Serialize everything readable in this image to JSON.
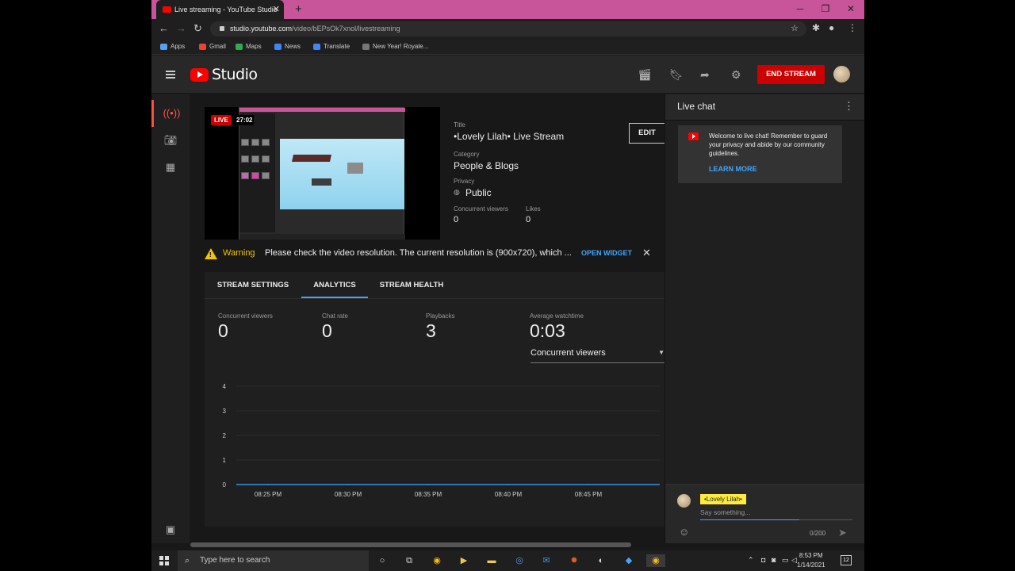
{
  "browser": {
    "tab_title": "Live streaming - YouTube Studio",
    "url_domain": "studio.youtube.com",
    "url_path": "/video/bEPsOk7xnol/livestreaming",
    "bookmarks": [
      "Apps",
      "Gmail",
      "Maps",
      "News",
      "Translate",
      "New Year! Royale..."
    ]
  },
  "header": {
    "logo_text": "Studio",
    "end_stream_label": "END STREAM"
  },
  "player": {
    "live_label": "LIVE",
    "elapsed": "27:02"
  },
  "stream_info": {
    "title_label": "Title",
    "title_value": "•Lovely Lilah• Live Stream",
    "category_label": "Category",
    "category_value": "People & Blogs",
    "privacy_label": "Privacy",
    "privacy_value": "Public",
    "viewers_label": "Concurrent viewers",
    "viewers_value": "0",
    "likes_label": "Likes",
    "likes_value": "0",
    "edit_label": "EDIT"
  },
  "warning": {
    "title": "Warning",
    "text": "Please check the video resolution. The current resolution is (900x720), which ...",
    "action": "OPEN WIDGET"
  },
  "tabs": [
    "STREAM SETTINGS",
    "ANALYTICS",
    "STREAM HEALTH"
  ],
  "active_tab": "ANALYTICS",
  "stats": [
    {
      "label": "Concurrent viewers",
      "value": "0"
    },
    {
      "label": "Chat rate",
      "value": "0"
    },
    {
      "label": "Playbacks",
      "value": "3"
    },
    {
      "label": "Average watchtime",
      "value": "0:03"
    }
  ],
  "metric_select": "Concurrent viewers",
  "chart_data": {
    "type": "line",
    "x": [
      "08:25 PM",
      "08:30 PM",
      "08:35 PM",
      "08:40 PM",
      "08:45 PM"
    ],
    "series": [
      {
        "values": [
          0,
          0,
          0,
          0,
          0
        ]
      }
    ],
    "yticks": [
      0,
      1,
      2,
      3,
      4
    ],
    "ylim": [
      0,
      4
    ],
    "grid": true,
    "line_color": "#3ea6ff"
  },
  "chat": {
    "title": "Live chat",
    "welcome": "Welcome to live chat! Remember to guard your privacy and abide by our community guidelines.",
    "learn_more": "LEARN MORE",
    "username": "•Lovely Lilah•",
    "placeholder": "Say something...",
    "counter": "0/200"
  },
  "taskbar": {
    "search_placeholder": "Type here to search",
    "time": "8:53 PM",
    "date": "1/14/2021",
    "notifications": "12"
  }
}
